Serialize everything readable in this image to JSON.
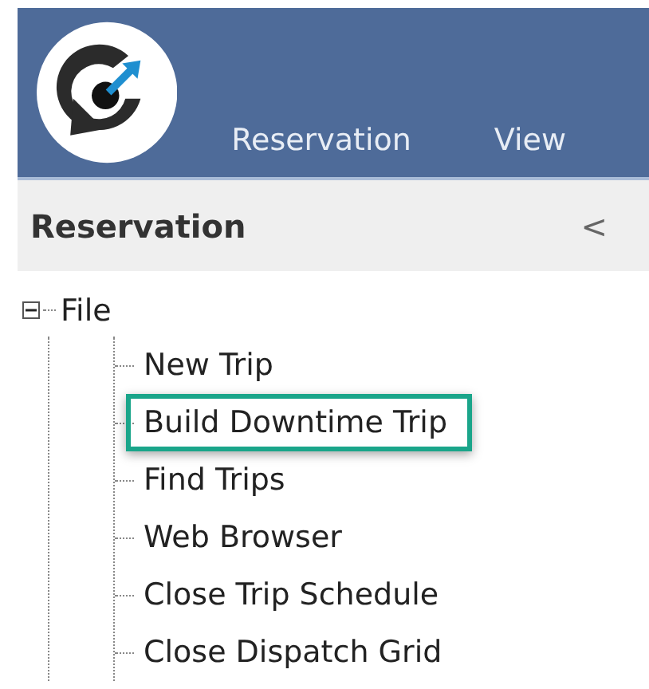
{
  "ribbon": {
    "tabs": [
      {
        "label": "Reservation",
        "selected": false
      },
      {
        "label": "View",
        "selected": false
      }
    ]
  },
  "panel": {
    "title": "Reservation",
    "collapse_glyph": "<"
  },
  "tree": [
    {
      "label": "File",
      "expanded": true,
      "children": [
        {
          "label": "New Trip",
          "highlighted": false
        },
        {
          "label": "Build Downtime Trip",
          "highlighted": true
        },
        {
          "label": "Find Trips",
          "highlighted": false
        },
        {
          "label": "Web Browser",
          "highlighted": false
        },
        {
          "label": "Close Trip Schedule",
          "highlighted": false
        },
        {
          "label": "Close Dispatch Grid",
          "highlighted": false
        }
      ]
    }
  ]
}
